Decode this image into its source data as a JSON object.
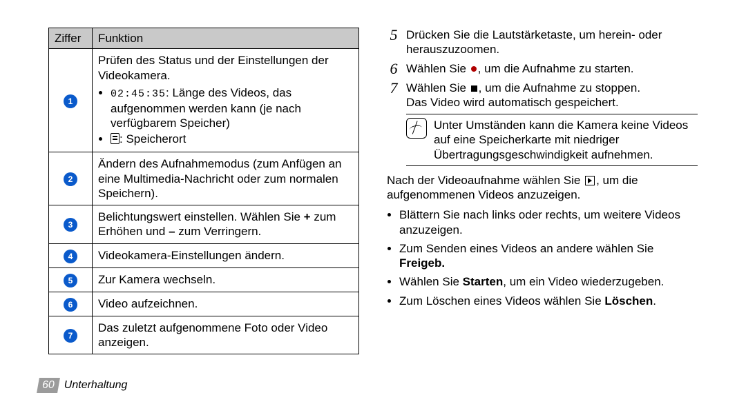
{
  "table": {
    "header": {
      "num": "Ziffer",
      "func": "Funktion"
    },
    "rows": [
      {
        "n": "1",
        "lead": "Prüfen des Status und der Einstellungen der Videokamera.",
        "b1_time": "02:45:35",
        "b1_rest": ": Länge des Videos, das aufgenommen werden kann (je nach verfügbarem Speicher)",
        "b2_rest": ": Speicherort"
      },
      {
        "n": "2",
        "text": "Ändern des Aufnahmemodus (zum Anfügen an eine Multimedia-Nachricht oder zum normalen Speichern)."
      },
      {
        "n": "3",
        "text_a": "Belichtungswert einstellen. Wählen Sie ",
        "plus": "+",
        "text_b": " zum Erhöhen und ",
        "minus": "–",
        "text_c": " zum Verringern."
      },
      {
        "n": "4",
        "text": "Videokamera-Einstellungen ändern."
      },
      {
        "n": "5",
        "text": "Zur Kamera wechseln."
      },
      {
        "n": "6",
        "text": "Video aufzeichnen."
      },
      {
        "n": "7",
        "text": "Das zuletzt aufgenommene Foto oder Video anzeigen."
      }
    ]
  },
  "steps": {
    "s5": "Drücken Sie die Lautstärketaste, um herein- oder herauszuzoomen.",
    "s6a": "Wählen Sie ",
    "s6b": ", um die Aufnahme zu starten.",
    "s7a": "Wählen Sie ",
    "s7b": ", um die Aufnahme zu stoppen.",
    "s7c": "Das Video wird automatisch gespeichert."
  },
  "note": "Unter Umständen kann die Kamera keine Videos auf eine Speicherkarte mit niedriger Übertragungsgeschwindigkeit aufnehmen.",
  "after": {
    "p1a": "Nach der Videoaufnahme wählen Sie ",
    "p1b": ", um die aufgenommenen Videos anzuzeigen.",
    "li1": "Blättern Sie nach links oder rechts, um weitere Videos anzuzeigen.",
    "li2a": "Zum Senden eines Videos an andere wählen Sie ",
    "li2b": "Freigeb.",
    "li3a": "Wählen Sie ",
    "li3b": "Starten",
    "li3c": ", um ein Video wiederzugeben.",
    "li4a": "Zum Löschen eines Videos wählen Sie ",
    "li4b": "Löschen",
    "li4c": "."
  },
  "footer": {
    "page": "60",
    "section": "Unterhaltung"
  }
}
